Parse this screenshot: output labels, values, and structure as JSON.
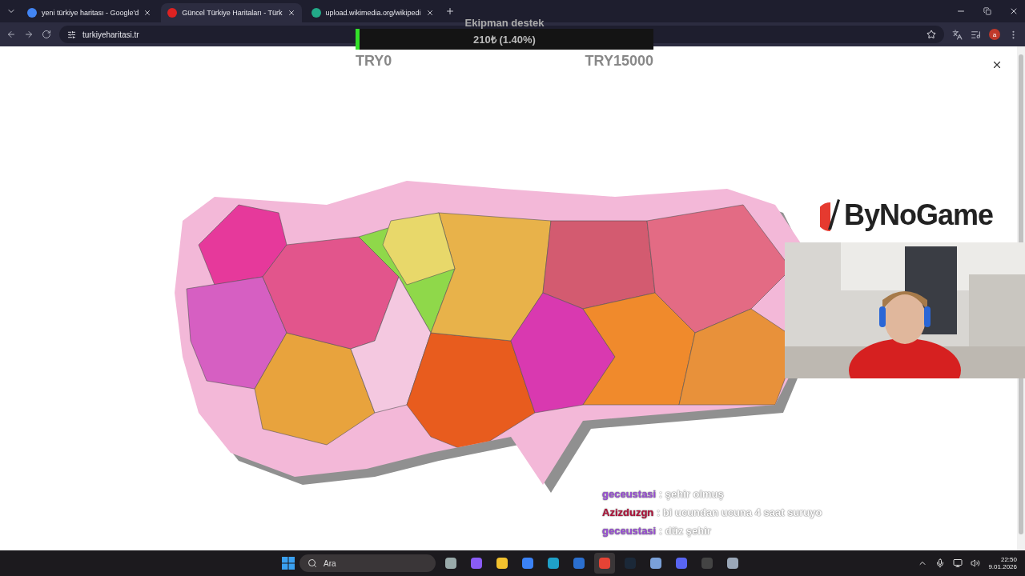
{
  "tabs": [
    {
      "title": "yeni türkiye haritası - Google'd",
      "selected": false
    },
    {
      "title": "Güncel Türkiye Haritaları - Türk",
      "selected": true
    },
    {
      "title": "upload.wikimedia.org/wikipedi",
      "selected": false
    }
  ],
  "address": "turkiyeharitasi.tr",
  "profile": "a",
  "donation": {
    "title": "Ekipman destek",
    "amount": "210₺ (1.40%)",
    "level": 0.014,
    "min": "TRY0",
    "max": "TRY15000"
  },
  "logo": "ByNoGame",
  "chat": [
    {
      "user": "geceustasi",
      "message": ": şehir olmuş",
      "color": "#9a4fd6"
    },
    {
      "user": "Azizduzgn",
      "message": ": bi ucundan ucuna 4 saat suruyo",
      "color": "#b0123a"
    },
    {
      "user": "geceustasi",
      "message": ": düz şehir",
      "color": "#9a4fd6"
    }
  ],
  "taskbar": {
    "search": "Ara",
    "apps": [
      {
        "kind": "files",
        "active": false
      },
      {
        "kind": "m365",
        "active": false
      },
      {
        "kind": "folder",
        "active": false
      },
      {
        "kind": "store",
        "active": false
      },
      {
        "kind": "edge",
        "active": false
      },
      {
        "kind": "mail",
        "active": false
      },
      {
        "kind": "chrome",
        "active": true
      },
      {
        "kind": "steam",
        "active": false
      },
      {
        "kind": "tool",
        "active": false
      },
      {
        "kind": "discord",
        "active": false
      },
      {
        "kind": "obs",
        "active": false
      },
      {
        "kind": "settings",
        "active": false
      }
    ],
    "time": "22:50",
    "date": "9.01.2026"
  }
}
